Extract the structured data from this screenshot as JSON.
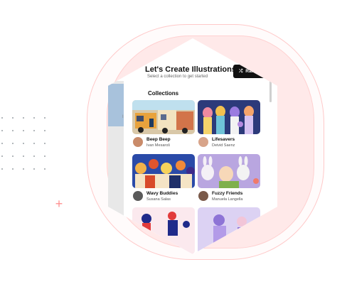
{
  "app": {
    "title": "Let's Create Illustrations!",
    "subtitle": "Select a collection to get started",
    "randomize_label": "Randomize",
    "collections_heading": "Collections",
    "left_label": "Ill"
  },
  "collections": [
    {
      "name": "Beep Beep",
      "author": "Ivan Mesaroš"
    },
    {
      "name": "Lifesavers",
      "author": "Deivid Saenz"
    },
    {
      "name": "Wavy Buddies",
      "author": "Susana Salas"
    },
    {
      "name": "Fuzzy Friends",
      "author": "Manuela Langella"
    }
  ],
  "icons": [
    "search-icon",
    "shuffle-icon"
  ],
  "colors": {
    "accent_pink": "#ff8f8f",
    "button_dark": "#111111",
    "blob_fill": "#ffe9e9"
  }
}
